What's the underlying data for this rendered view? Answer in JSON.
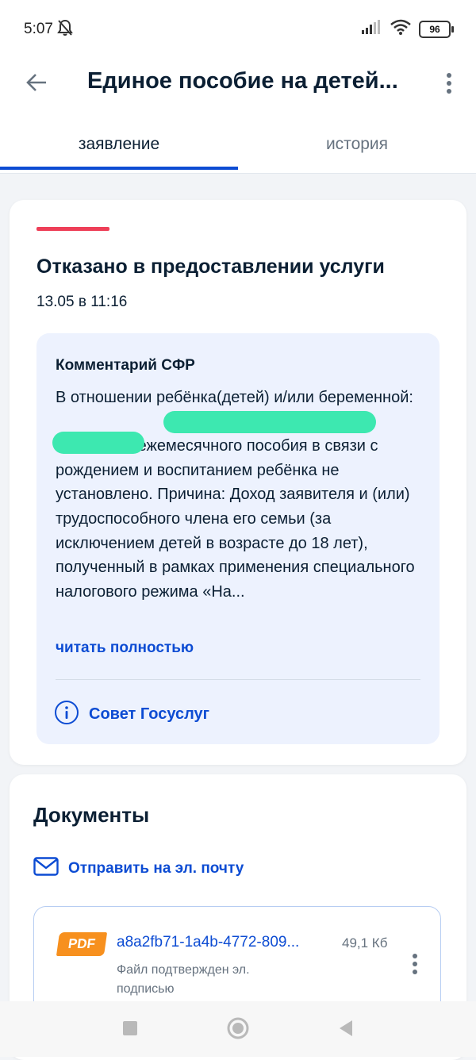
{
  "status_bar": {
    "time": "5:07",
    "battery": "96",
    "icons": [
      "bell-off-icon",
      "signal-icon",
      "wifi-icon",
      "battery-icon"
    ]
  },
  "app_bar": {
    "title": "Единое пособие на детей...",
    "back_icon": "arrow-left-icon",
    "more_icon": "more-vertical-icon"
  },
  "tabs": [
    {
      "label": "заявление",
      "active": true
    },
    {
      "label": "история",
      "active": false
    }
  ],
  "status_card": {
    "accent_color": "#ee3f58",
    "title": "Отказано в предоставлении услуги",
    "date": "13.05 в 11:16",
    "comment": {
      "title": "Комментарий СФР",
      "text": "В отношении ребёнка(детей) и/или беременной:                                                      право на получение ежемесячного пособия в связи с рождением и воспитанием ребёнка не установлено. Причина: Доход заявителя и (или) трудоспособного члена его семьи (за исключением детей в возрасте до 18 лет), полученный в рамках применения специального налогового режима «На...",
      "read_more": "читать полностью",
      "advice": "Совет Госуслуг"
    }
  },
  "documents": {
    "title": "Документы",
    "send_email": "Отправить на эл. почту",
    "items": [
      {
        "badge": "PDF",
        "name": "a8a2fb71-1a4b-4772-809...",
        "size": "49,1 Кб",
        "signature": "Файл подтвержден эл. подписью"
      }
    ]
  },
  "nav_bar": {
    "icons": [
      "recent-apps-icon",
      "home-icon",
      "back-triangle-icon"
    ]
  },
  "colors": {
    "primary": "#0d4cd3",
    "text": "#0b1f33",
    "muted": "#66727f",
    "comment_bg": "#edf2fe",
    "pdf": "#f7901e",
    "redaction": "#3de8b0"
  }
}
